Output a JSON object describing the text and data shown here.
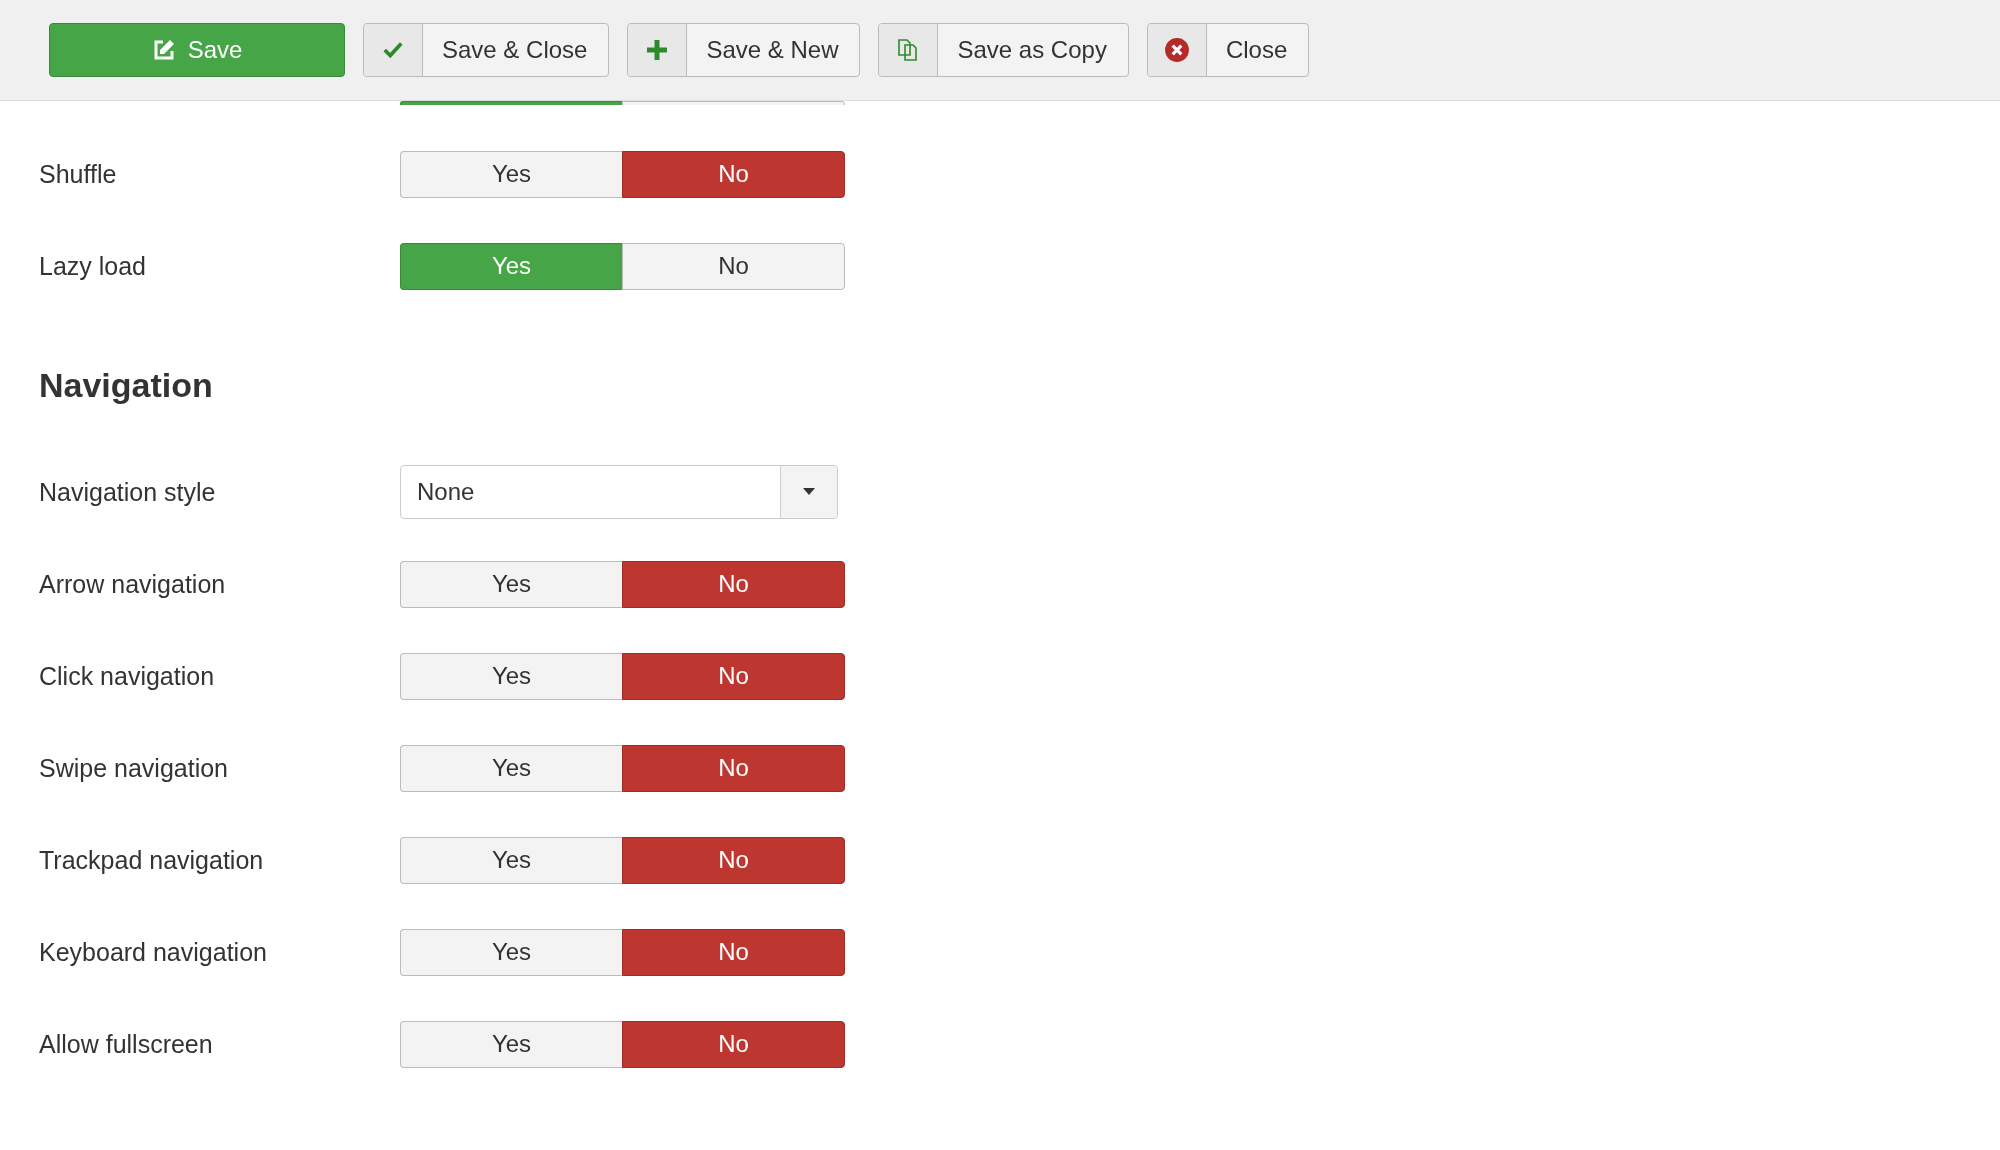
{
  "toolbar": {
    "buttons": [
      {
        "kind": "primary",
        "label": "Save"
      },
      {
        "kind": "split",
        "label": "Save & Close"
      },
      {
        "kind": "split",
        "label": "Save & New"
      },
      {
        "kind": "split",
        "label": "Save as Copy"
      },
      {
        "kind": "split",
        "label": "Close"
      }
    ]
  },
  "clipped_toggle": {
    "options": [
      {
        "selected": true
      },
      {
        "selected": false
      }
    ]
  },
  "sections": [
    {
      "fields": [
        {
          "kind": "toggle",
          "label": "Shuffle",
          "options": [
            {
              "label": "Yes",
              "selected": false
            },
            {
              "label": "No",
              "selected": true
            }
          ]
        },
        {
          "kind": "toggle",
          "label": "Lazy load",
          "options": [
            {
              "label": "Yes",
              "selected": true
            },
            {
              "label": "No",
              "selected": false
            }
          ]
        }
      ]
    },
    {
      "title": "Navigation",
      "fields": [
        {
          "kind": "select",
          "label": "Navigation style",
          "value": "None"
        },
        {
          "kind": "toggle",
          "label": "Arrow navigation",
          "options": [
            {
              "label": "Yes",
              "selected": false
            },
            {
              "label": "No",
              "selected": true
            }
          ]
        },
        {
          "kind": "toggle",
          "label": "Click navigation",
          "options": [
            {
              "label": "Yes",
              "selected": false
            },
            {
              "label": "No",
              "selected": true
            }
          ]
        },
        {
          "kind": "toggle",
          "label": "Swipe navigation",
          "options": [
            {
              "label": "Yes",
              "selected": false
            },
            {
              "label": "No",
              "selected": true
            }
          ]
        },
        {
          "kind": "toggle",
          "label": "Trackpad navigation",
          "options": [
            {
              "label": "Yes",
              "selected": false
            },
            {
              "label": "No",
              "selected": true
            }
          ]
        },
        {
          "kind": "toggle",
          "label": "Keyboard navigation",
          "options": [
            {
              "label": "Yes",
              "selected": false
            },
            {
              "label": "No",
              "selected": true
            }
          ]
        },
        {
          "kind": "toggle",
          "label": "Allow fullscreen",
          "options": [
            {
              "label": "Yes",
              "selected": false
            },
            {
              "label": "No",
              "selected": true
            }
          ]
        }
      ]
    }
  ]
}
